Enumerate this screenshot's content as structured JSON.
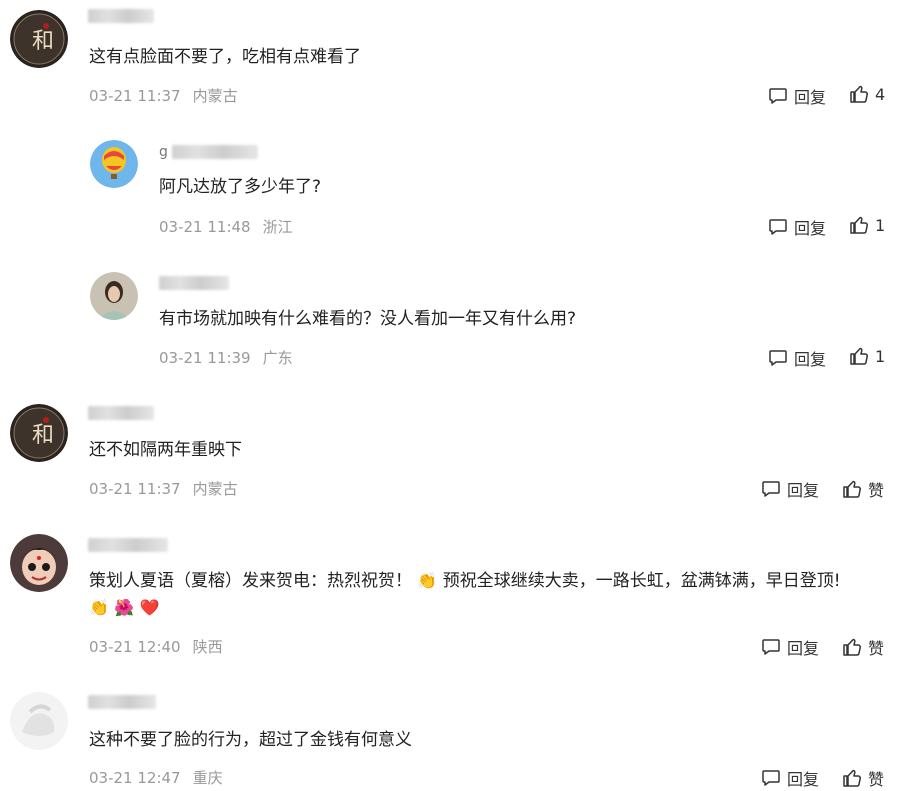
{
  "actions": {
    "reply_label": "回复",
    "like_label_default": "赞"
  },
  "comments": [
    {
      "username_prefix": "",
      "text": "这有点脸面不要了，吃相有点难看了",
      "date": "03-21 11:37",
      "location": "内蒙古",
      "likes": "4",
      "avatar": "calligraphy-avatar"
    },
    {
      "username_prefix": "g",
      "text": "阿凡达放了多少年了?",
      "date": "03-21 11:48",
      "location": "浙江",
      "likes": "1",
      "avatar": "hot-air-balloon-avatar"
    },
    {
      "username_prefix": "",
      "text": "有市场就加映有什么难看的？没人看加一年又有什么用?",
      "date": "03-21 11:39",
      "location": "广东",
      "likes": "1",
      "avatar": "woman-portrait-avatar"
    },
    {
      "username_prefix": "",
      "text": "还不如隔两年重映下",
      "date": "03-21 11:37",
      "location": "内蒙古",
      "likes": "赞",
      "avatar": "calligraphy-avatar"
    },
    {
      "username_prefix": "",
      "text_line1_a": "策划人夏语（夏榕）发来贺电：热烈祝贺！",
      "text_line1_b": "预祝全球继续大卖，一路长虹，盆满钵满，早日登顶!",
      "emoji_clap": "👏",
      "emoji_flower": "🌺",
      "emoji_heart": "❤️",
      "date": "03-21 12:40",
      "location": "陕西",
      "likes": "赞",
      "avatar": "cartoon-boy-avatar"
    },
    {
      "username_prefix": "",
      "text": "这种不要了脸的行为，超过了金钱有何意义",
      "date": "03-21 12:47",
      "location": "重庆",
      "likes": "赞",
      "avatar": "white-abstract-avatar"
    }
  ],
  "colors": {
    "meta": "#999999",
    "text": "#222222",
    "action": "#333333"
  }
}
